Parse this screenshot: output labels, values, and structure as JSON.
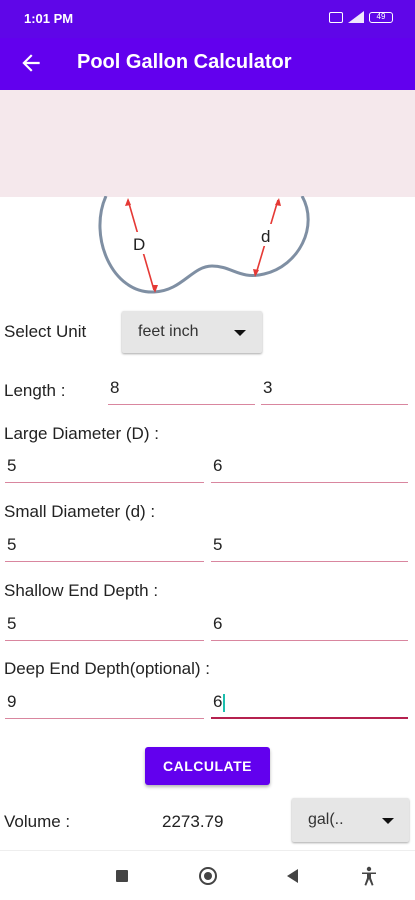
{
  "status": {
    "time": "1:01 PM",
    "battery": "49"
  },
  "app_bar": {
    "title": "Pool Gallon Calculator"
  },
  "diagram": {
    "large_label": "D",
    "small_label": "d"
  },
  "unit": {
    "label": "Select Unit",
    "selected": "feet inch"
  },
  "length": {
    "label": "Length :",
    "feet": "8",
    "inch": "3"
  },
  "large_diameter": {
    "label": "Large Diameter (D) :",
    "feet": "5",
    "inch": "6"
  },
  "small_diameter": {
    "label": "Small Diameter (d) :",
    "feet": "5",
    "inch": "5"
  },
  "shallow_depth": {
    "label": "Shallow End Depth :",
    "feet": "5",
    "inch": "6"
  },
  "deep_depth": {
    "label": "Deep End Depth(optional) :",
    "feet": "9",
    "inch": "6"
  },
  "calculate_label": "CALCULATE",
  "result": {
    "label": "Volume :",
    "value": "2273.79",
    "unit_selected": "gal(.."
  },
  "colors": {
    "accent": "#6200ee",
    "underline": "#d9869f",
    "cursor": "#1dbfae"
  },
  "icons": [
    "back-arrow-icon",
    "caret-down-icon",
    "nav-recents-icon",
    "nav-home-icon",
    "nav-back-icon",
    "accessibility-icon"
  ]
}
